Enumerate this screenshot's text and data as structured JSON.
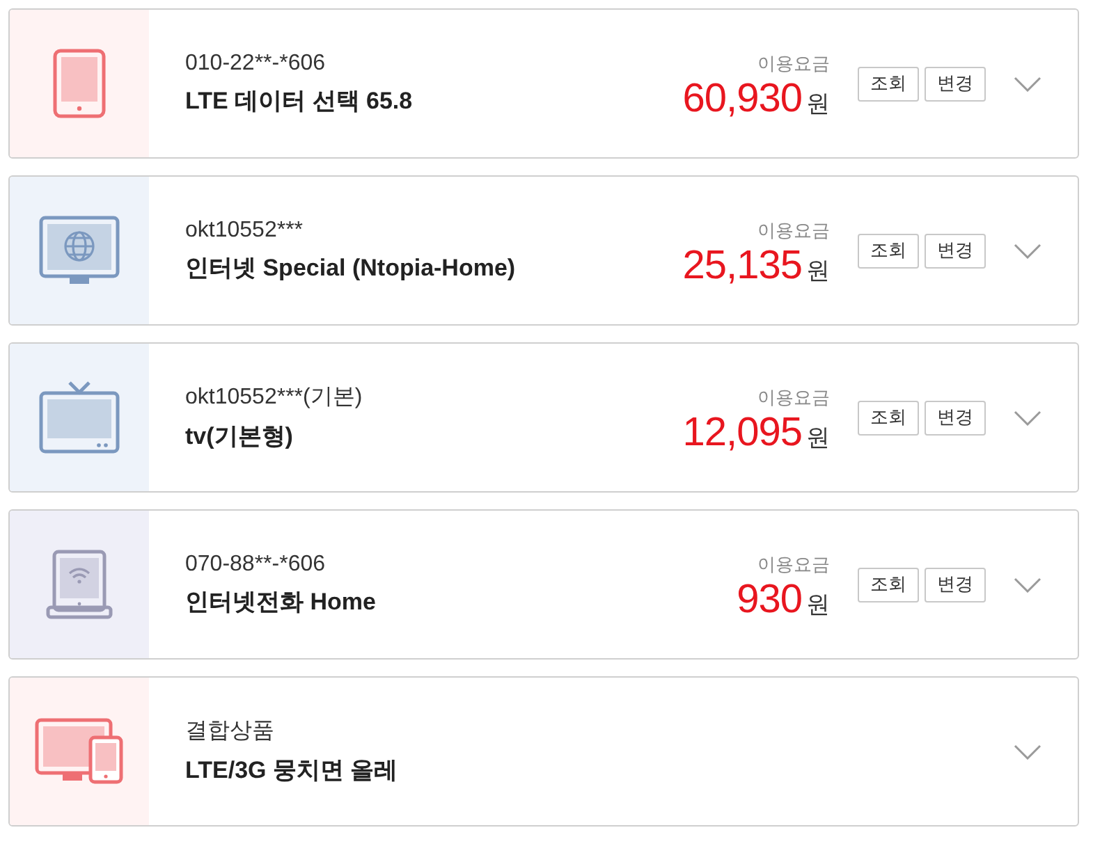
{
  "services": [
    {
      "kind": "tablet",
      "account": "010-22**-*606",
      "product": "LTE 데이터 선택 65.8",
      "fee_label": "이용요금",
      "amount": "60,930",
      "unit": "원",
      "buttons": [
        "조회",
        "변경"
      ],
      "expanded": false
    },
    {
      "kind": "internet",
      "account": "okt10552***",
      "product": "인터넷 Special (Ntopia-Home)",
      "fee_label": "이용요금",
      "amount": "25,135",
      "unit": "원",
      "buttons": [
        "조회",
        "변경"
      ],
      "expanded": false
    },
    {
      "kind": "tv",
      "account": "okt10552***(기본)",
      "product": "tv(기본형)",
      "fee_label": "이용요금",
      "amount": "12,095",
      "unit": "원",
      "buttons": [
        "조회",
        "변경"
      ],
      "expanded": false
    },
    {
      "kind": "phone",
      "account": "070-88**-*606",
      "product": "인터넷전화 Home",
      "fee_label": "이용요금",
      "amount": "930",
      "unit": "원",
      "buttons": [
        "조회",
        "변경"
      ],
      "expanded": false
    },
    {
      "kind": "bundle",
      "account": "결합상품",
      "product": "LTE/3G 뭉치면 올레",
      "expanded": false
    }
  ]
}
